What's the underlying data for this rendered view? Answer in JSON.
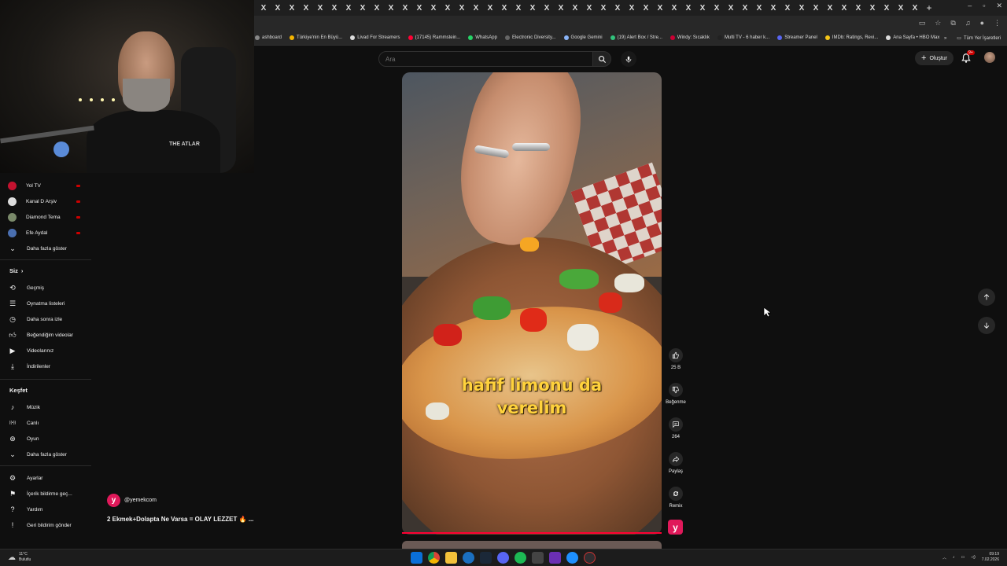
{
  "browser": {
    "tab_count": 47,
    "tab_glyph": "X",
    "new_tab": "+",
    "window_controls": [
      "–",
      "▫",
      "✕"
    ],
    "bookmarks": [
      {
        "label": "ashboard",
        "color": "#888888"
      },
      {
        "label": "Türkiye'nin En Büyü...",
        "color": "#f4b400"
      },
      {
        "label": "Livad For Streamers",
        "color": "#dddddd"
      },
      {
        "label": "(17145) Rammstein...",
        "color": "#ff0033"
      },
      {
        "label": "WhatsApp",
        "color": "#25d366"
      },
      {
        "label": "Electronic Diversity...",
        "color": "#666666"
      },
      {
        "label": "Google Gemini",
        "color": "#8ab4f8"
      },
      {
        "label": "(19) Alert Box / Stre...",
        "color": "#31c27c"
      },
      {
        "label": "Windy: Sıcaklık",
        "color": "#cc0033"
      },
      {
        "label": "Multi TV - 6 haber k...",
        "color": "#222222"
      },
      {
        "label": "Streamer Panel",
        "color": "#5865f2"
      },
      {
        "label": "IMDb: Ratings, Revi...",
        "color": "#f5c518"
      },
      {
        "label": "Ana Sayfa • HBO Max",
        "color": "#dddddd"
      }
    ],
    "bookmarks_more": "»",
    "bookmarks_all": "Tüm Yer İşaretleri"
  },
  "header": {
    "search_placeholder": "Ara",
    "create_label": "Oluştur",
    "notif_badge": "9+"
  },
  "sidebar": {
    "subscriptions": [
      {
        "label": "Yol TV",
        "color": "#c4122f",
        "live": true
      },
      {
        "label": "Kanal D Arşiv",
        "color": "#dddddd",
        "live": true
      },
      {
        "label": "Diamond Tema",
        "color": "#7a8a6a",
        "live": true
      },
      {
        "label": "Efe Aydal",
        "color": "#4a6fb0",
        "live": true
      }
    ],
    "show_more_subs": "Daha fazla göster",
    "you_heading": "Siz",
    "you_items": [
      {
        "label": "Geçmiş",
        "icon": "history-icon"
      },
      {
        "label": "Oynatma listeleri",
        "icon": "playlist-icon"
      },
      {
        "label": "Daha sonra izle",
        "icon": "clock-icon"
      },
      {
        "label": "Beğendiğim videolar",
        "icon": "thumb-up-icon"
      },
      {
        "label": "Videolarınız",
        "icon": "video-icon"
      },
      {
        "label": "İndirilenler",
        "icon": "download-icon"
      }
    ],
    "explore_heading": "Keşfet",
    "explore_items": [
      {
        "label": "Müzik",
        "icon": "music-icon"
      },
      {
        "label": "Canlı",
        "icon": "live-icon"
      },
      {
        "label": "Oyun",
        "icon": "gaming-icon"
      }
    ],
    "show_more_explore": "Daha fazla göster",
    "footer_items": [
      {
        "label": "Ayarlar",
        "icon": "gear-icon"
      },
      {
        "label": "İçerik bildirme geç...",
        "icon": "flag-icon"
      },
      {
        "label": "Yardım",
        "icon": "help-icon"
      },
      {
        "label": "Geri bildirim gönder",
        "icon": "feedback-icon"
      }
    ]
  },
  "short": {
    "caption_line1": "hafif limonu da",
    "caption_line2": "verelim",
    "channel_handle": "@yemekcom",
    "channel_initial": "y",
    "title": "2 Ekmek+Dolapta Ne Varsa = OLAY LEZZET 🔥 ...",
    "likes": "25 B",
    "dislike_label": "Beğenme",
    "comments": "264",
    "share_label": "Paylaş",
    "remix_label": "Remix"
  },
  "webcam": {
    "shirt_text": "THE ATLAR"
  },
  "taskbar": {
    "temp": "11°C",
    "weather": "Bulutlu",
    "time": "09:19",
    "date": "7.02.2026"
  },
  "colors": {
    "accent_red": "#ff0033",
    "caption_yellow": "#ffd23c",
    "brand_pink": "#e0195a"
  }
}
